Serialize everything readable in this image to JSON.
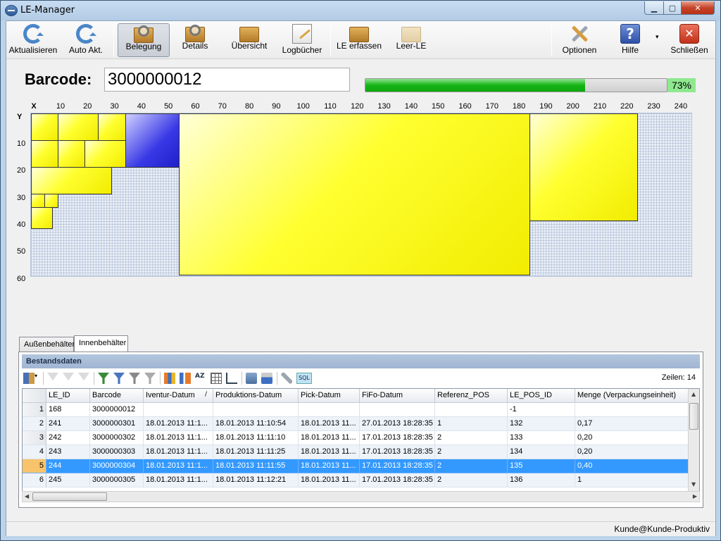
{
  "window": {
    "title": "LE-Manager",
    "minimize": "▁",
    "maximize": "▢",
    "close": "✕"
  },
  "toolbar": {
    "aktualisieren": "Aktualisieren",
    "auto_akt": "Auto Akt.",
    "belegung": "Belegung",
    "details": "Details",
    "uebersicht": "Übersicht",
    "logbuecher": "Logbücher",
    "le_erfassen": "LE erfassen",
    "leer_le": "Leer-LE",
    "optionen": "Optionen",
    "hilfe": "Hilfe",
    "hilfe_icon": "?",
    "schliessen": "Schließen",
    "schliessen_icon": "✕",
    "dropdown": "▾"
  },
  "barcode": {
    "label": "Barcode:",
    "value": "3000000012"
  },
  "progress": {
    "fraction": 0.73,
    "label": "73%"
  },
  "layout_view": {
    "x_axis_label": "X",
    "y_axis_label": "Y",
    "x_ticks": [
      "10",
      "20",
      "30",
      "40",
      "50",
      "60",
      "70",
      "80",
      "90",
      "100",
      "110",
      "120",
      "130",
      "140",
      "150",
      "160",
      "170",
      "180",
      "190",
      "200",
      "210",
      "220",
      "230",
      "240"
    ],
    "y_ticks": [
      "10",
      "20",
      "30",
      "40",
      "50",
      "60"
    ]
  },
  "tabs": {
    "aussen": "Außenbehälter",
    "innen": "Innenbehälter"
  },
  "grid": {
    "title": "Bestandsdaten",
    "rows_label": "Zeilen: 14",
    "sql": "SQL",
    "columns": [
      "LE_ID",
      "Barcode",
      "Iventur-Datum",
      "Produktions-Datum",
      "Pick-Datum",
      "FiFo-Datum",
      "Referenz_POS",
      "LE_POS_ID",
      "Menge (Verpackungseinheit)"
    ],
    "sort_indicator": "/",
    "rows": [
      {
        "num": "1",
        "cells": [
          "168",
          "3000000012",
          "",
          "",
          "",
          "",
          "",
          "-1",
          ""
        ]
      },
      {
        "num": "2",
        "cells": [
          "241",
          "3000000301",
          "18.01.2013 11:1...",
          "18.01.2013 11:10:54",
          "18.01.2013 11...",
          "27.01.2013 18:28:35",
          "1",
          "132",
          "0,17"
        ]
      },
      {
        "num": "3",
        "cells": [
          "242",
          "3000000302",
          "18.01.2013 11:1...",
          "18.01.2013 11:11:10",
          "18.01.2013 11...",
          "17.01.2013 18:28:35",
          "2",
          "133",
          "0,20"
        ]
      },
      {
        "num": "4",
        "cells": [
          "243",
          "3000000303",
          "18.01.2013 11:1...",
          "18.01.2013 11:11:25",
          "18.01.2013 11...",
          "17.01.2013 18:28:35",
          "2",
          "134",
          "0,20"
        ]
      },
      {
        "num": "5",
        "cells": [
          "244",
          "3000000304",
          "18.01.2013 11:1...",
          "18.01.2013 11:11:55",
          "18.01.2013 11...",
          "17.01.2013 18:28:35",
          "2",
          "135",
          "0,40"
        ]
      },
      {
        "num": "6",
        "cells": [
          "245",
          "3000000305",
          "18.01.2013 11:1...",
          "18.01.2013 11:12:21",
          "18.01.2013 11...",
          "17.01.2013 18:28:35",
          "2",
          "136",
          "1"
        ]
      }
    ],
    "selected_row": 4
  },
  "status": {
    "user": "Kunde@Kunde-Produktiv"
  }
}
